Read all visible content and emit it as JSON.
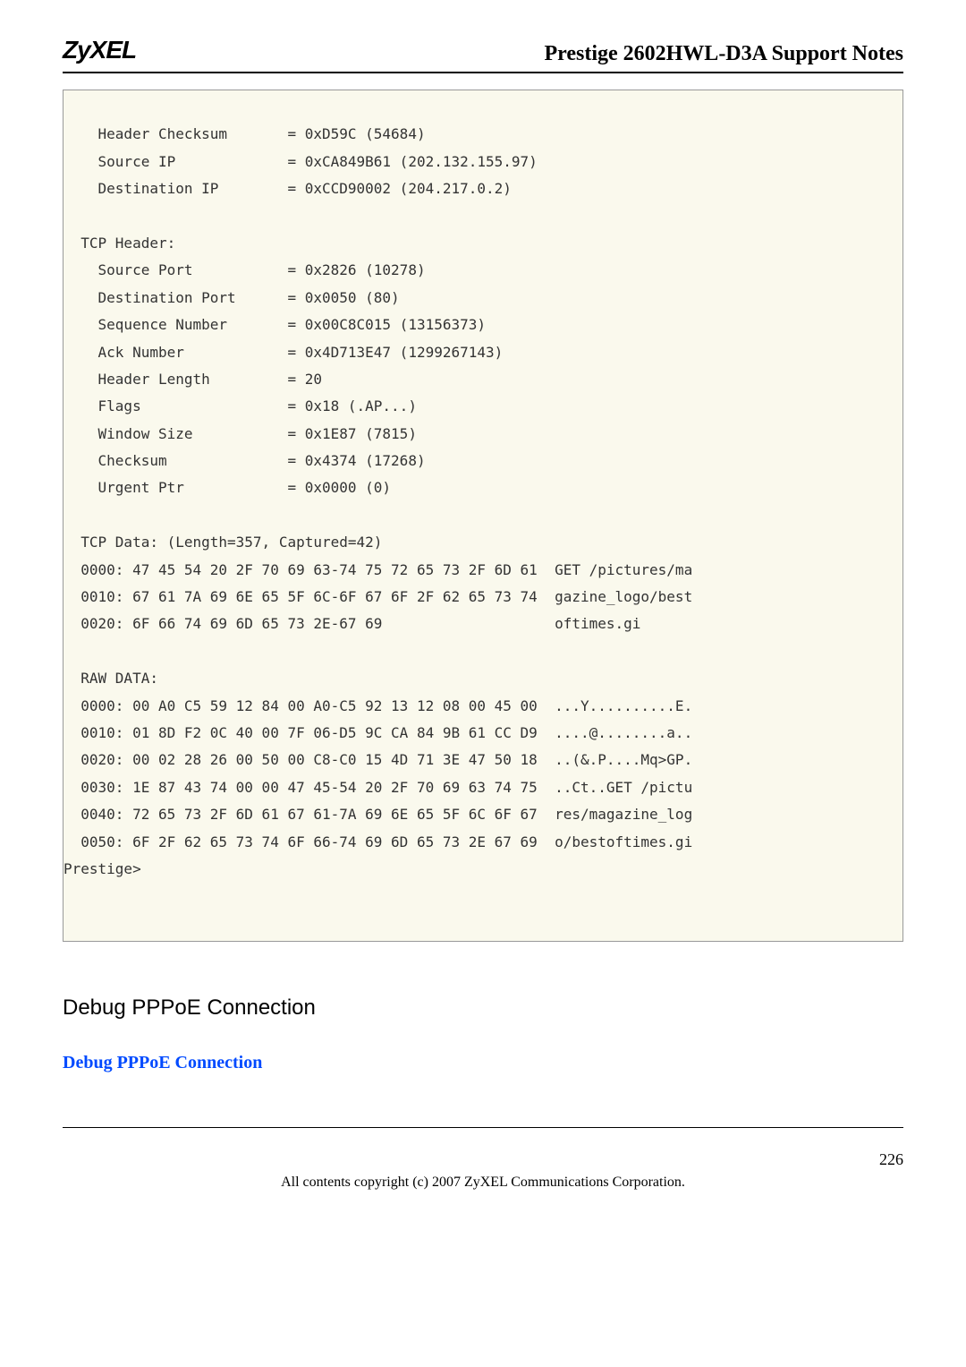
{
  "header": {
    "logo": "ZyXEL",
    "title": "Prestige 2602HWL-D3A Support Notes"
  },
  "code": "    Header Checksum       = 0xD59C (54684)\n    Source IP             = 0xCA849B61 (202.132.155.97)\n    Destination IP        = 0xCCD90002 (204.217.0.2)\n\n  TCP Header:\n    Source Port           = 0x2826 (10278)\n    Destination Port      = 0x0050 (80)\n    Sequence Number       = 0x00C8C015 (13156373)\n    Ack Number            = 0x4D713E47 (1299267143)\n    Header Length         = 20\n    Flags                 = 0x18 (.AP...)\n    Window Size           = 0x1E87 (7815)\n    Checksum              = 0x4374 (17268)\n    Urgent Ptr            = 0x0000 (0)\n\n  TCP Data: (Length=357, Captured=42)\n  0000: 47 45 54 20 2F 70 69 63-74 75 72 65 73 2F 6D 61  GET /pictures/ma\n  0010: 67 61 7A 69 6E 65 5F 6C-6F 67 6F 2F 62 65 73 74  gazine_logo/best\n  0020: 6F 66 74 69 6D 65 73 2E-67 69                    oftimes.gi\n\n  RAW DATA:\n  0000: 00 A0 C5 59 12 84 00 A0-C5 92 13 12 08 00 45 00  ...Y..........E.\n  0010: 01 8D F2 0C 40 00 7F 06-D5 9C CA 84 9B 61 CC D9  ....@........a..\n  0020: 00 02 28 26 00 50 00 C8-C0 15 4D 71 3E 47 50 18  ..(&.P....Mq>GP.\n  0030: 1E 87 43 74 00 00 47 45-54 20 2F 70 69 63 74 75  ..Ct..GET /pictu\n  0040: 72 65 73 2F 6D 61 67 61-7A 69 6E 65 5F 6C 6F 67  res/magazine_log\n  0050: 6F 2F 62 65 73 74 6F 66-74 69 6D 65 73 2E 67 69  o/bestoftimes.gi\nPrestige>\n",
  "h2": "Debug PPPoE Connection",
  "subhead": "Debug PPPoE Connection",
  "footer": {
    "page": "226",
    "copyright": "All contents copyright (c) 2007 ZyXEL Communications Corporation."
  }
}
